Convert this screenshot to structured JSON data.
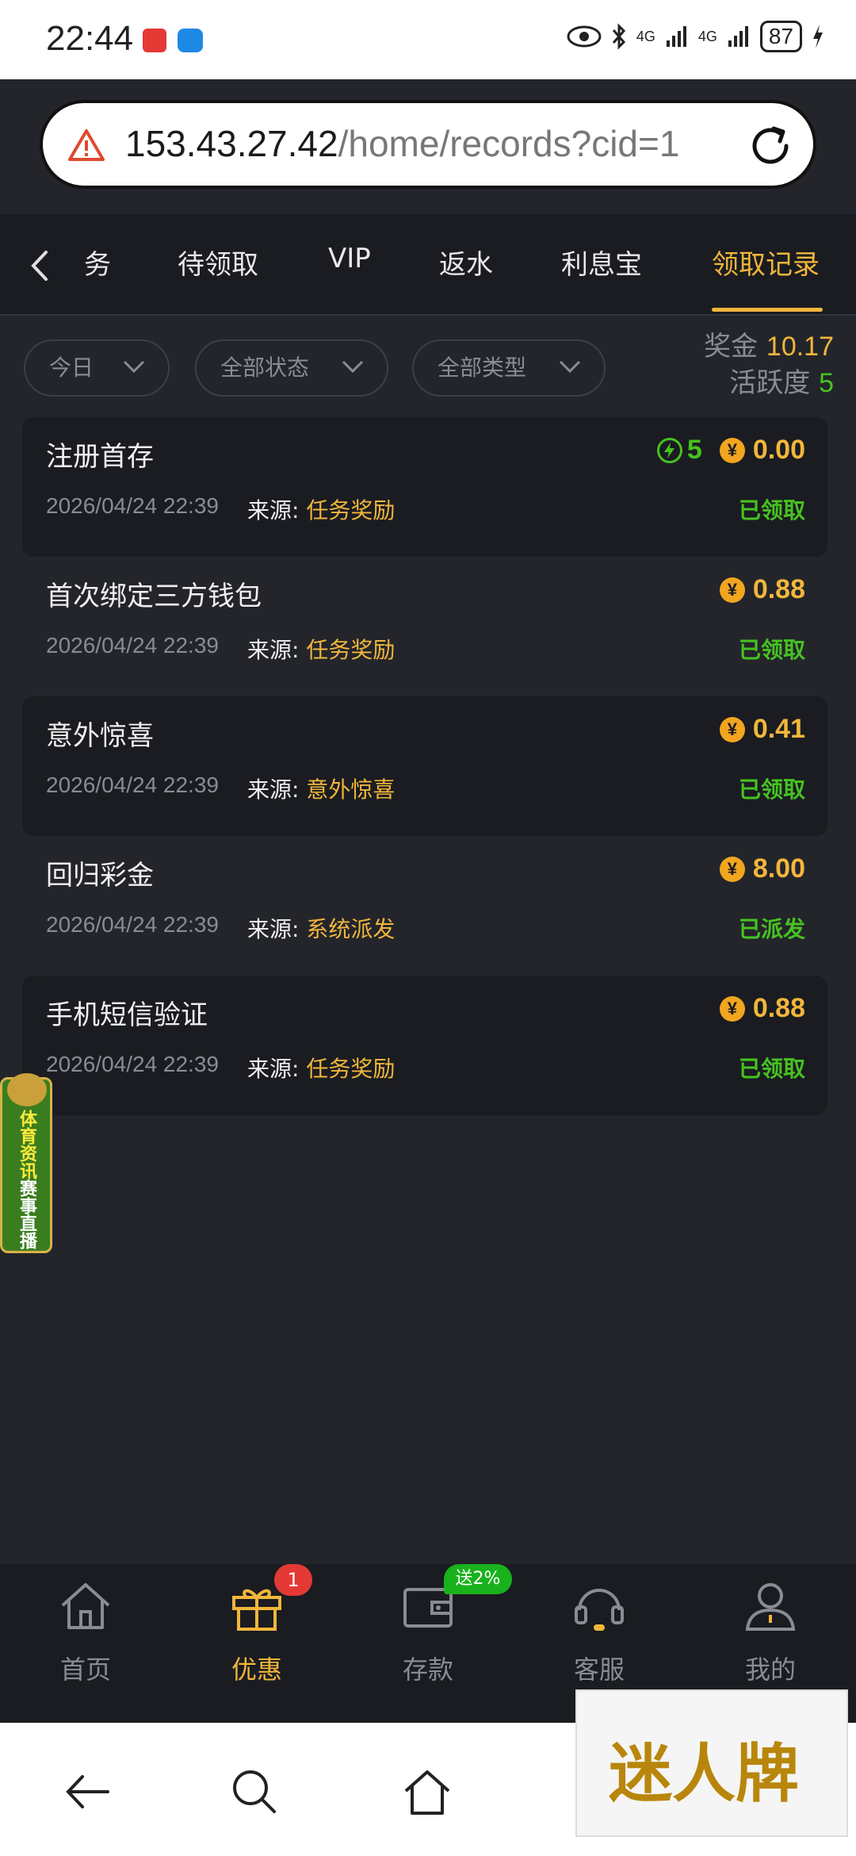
{
  "status_bar": {
    "time": "22:44",
    "signal1": "4G",
    "signal2": "4G",
    "battery": "87"
  },
  "browser": {
    "url_host": "153.43.27.42",
    "url_path": "/home/records?cid=1"
  },
  "tabs": [
    {
      "label": "务"
    },
    {
      "label": "待领取"
    },
    {
      "label": "VIP"
    },
    {
      "label": "返水"
    },
    {
      "label": "利息宝"
    },
    {
      "label": "领取记录"
    }
  ],
  "filters": {
    "date": "今日",
    "status": "全部状态",
    "type": "全部类型"
  },
  "stats": {
    "bonus_label": "奖金",
    "bonus_value": "10.17",
    "activity_label": "活跃度",
    "activity_value": "5"
  },
  "records": [
    {
      "title": "注册首存",
      "activity": "5",
      "amount": "0.00",
      "date": "2026/04/24 22:39",
      "source_label": "来源:",
      "source": "任务奖励",
      "status": "已领取"
    },
    {
      "title": "首次绑定三方钱包",
      "amount": "0.88",
      "date": "2026/04/24 22:39",
      "source_label": "来源:",
      "source": "任务奖励",
      "status": "已领取"
    },
    {
      "title": "意外惊喜",
      "amount": "0.41",
      "date": "2026/04/24 22:39",
      "source_label": "来源:",
      "source": "意外惊喜",
      "status": "已领取"
    },
    {
      "title": "回归彩金",
      "amount": "8.00",
      "date": "2026/04/24 22:39",
      "source_label": "来源:",
      "source": "系统派发",
      "status": "已派发"
    },
    {
      "title": "手机短信验证",
      "amount": "0.88",
      "date": "2026/04/24 22:39",
      "source_label": "来源:",
      "source": "任务奖励",
      "status": "已领取"
    }
  ],
  "side_banner": {
    "line1": "体育资讯",
    "line2": "赛事直播"
  },
  "bottom_nav": {
    "items": [
      {
        "label": "首页"
      },
      {
        "label": "优惠"
      },
      {
        "label": "存款"
      },
      {
        "label": "客服"
      },
      {
        "label": "我的"
      }
    ],
    "promo_badge": "1",
    "deposit_badge": "送2%"
  },
  "watermark": "迷人牌",
  "colors": {
    "accent": "#f2b63b",
    "success": "#46c21f",
    "background": "#23252b",
    "card": "#1a1c21"
  }
}
